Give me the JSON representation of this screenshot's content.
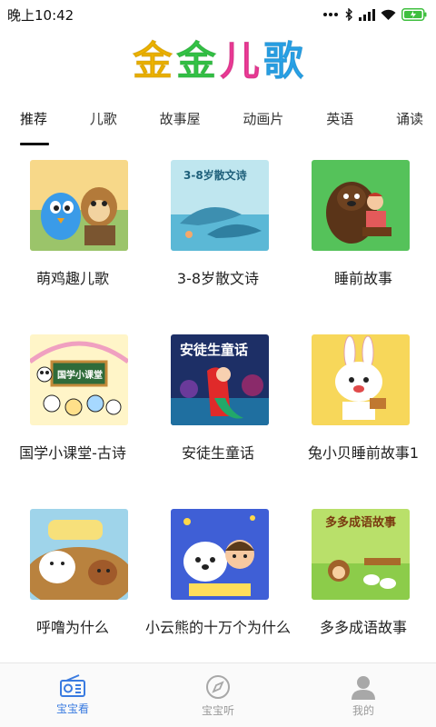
{
  "status_bar": {
    "time": "晚上10:42",
    "icons": [
      "dots-icon",
      "bluetooth-icon",
      "signal-icon",
      "wifi-icon",
      "battery-icon"
    ],
    "battery_color": "#3fbf3f"
  },
  "logo": {
    "chars": [
      "金",
      "金",
      "儿",
      "歌"
    ],
    "colors": [
      "#f5b800",
      "#36c948",
      "#f23b9a",
      "#2aa8f0"
    ]
  },
  "tabs": [
    {
      "label": "推荐",
      "active": true
    },
    {
      "label": "儿歌",
      "active": false
    },
    {
      "label": "故事屋",
      "active": false
    },
    {
      "label": "动画片",
      "active": false
    },
    {
      "label": "英语",
      "active": false
    },
    {
      "label": "诵读",
      "active": false
    }
  ],
  "cards": [
    {
      "title": "萌鸡趣儿歌",
      "thumb_text": ""
    },
    {
      "title": "3-8岁散文诗",
      "thumb_text": "3-8岁散文诗"
    },
    {
      "title": "睡前故事",
      "thumb_text": ""
    },
    {
      "title": "国学小课堂-古诗",
      "thumb_text": "国学小课堂"
    },
    {
      "title": "安徒生童话",
      "thumb_text": "安徒生童话"
    },
    {
      "title": "兔小贝睡前故事1",
      "thumb_text": ""
    },
    {
      "title": "呼噜为什么",
      "thumb_text": ""
    },
    {
      "title": "小云熊的十万个为什么",
      "thumb_text": ""
    },
    {
      "title": "多多成语故事",
      "thumb_text": "多多成语故事"
    }
  ],
  "bottom_nav": [
    {
      "label": "宝宝看",
      "icon": "radio-icon",
      "active": true
    },
    {
      "label": "宝宝听",
      "icon": "compass-icon",
      "active": false
    },
    {
      "label": "我的",
      "icon": "person-icon",
      "active": false
    }
  ],
  "colors": {
    "accent": "#3a7be0",
    "inactive": "#9a9a9a"
  }
}
